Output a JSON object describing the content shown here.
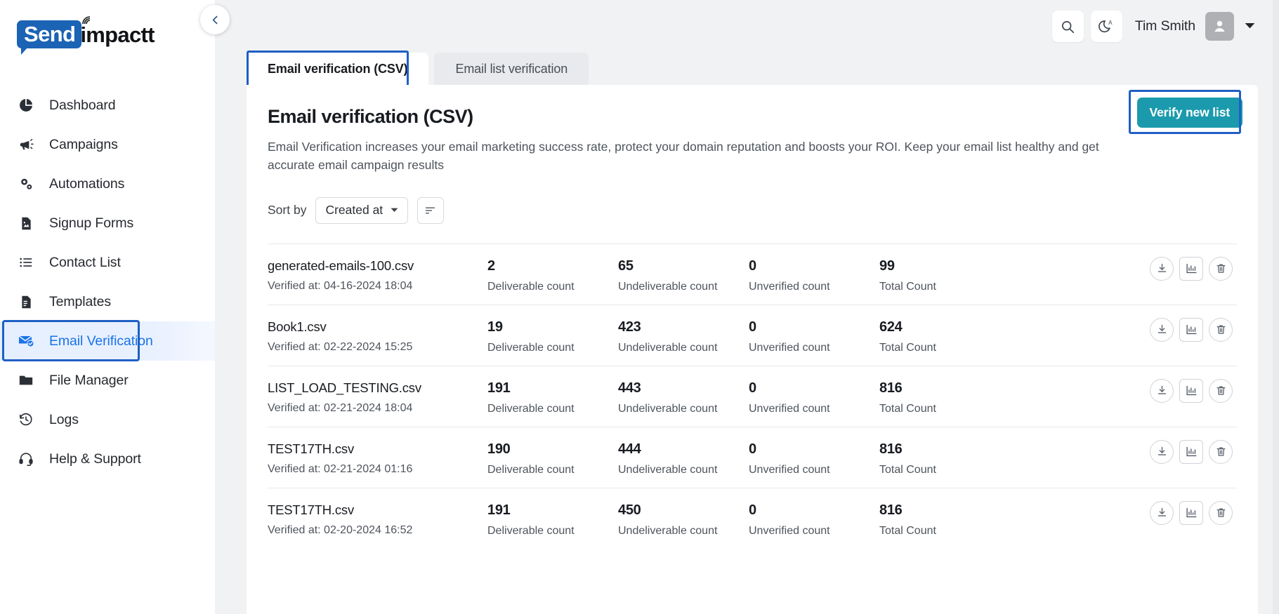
{
  "brand": {
    "word_mark_primary": "Send",
    "word_mark_secondary": "impactt",
    "primary_color": "#1b63b5"
  },
  "sidebar": {
    "collapse_icon": "chevron-left-icon",
    "items": [
      {
        "label": "Dashboard",
        "icon": "pie-chart-icon",
        "active": false
      },
      {
        "label": "Campaigns",
        "icon": "megaphone-icon",
        "active": false
      },
      {
        "label": "Automations",
        "icon": "gears-icon",
        "active": false
      },
      {
        "label": "Signup Forms",
        "icon": "form-image-icon",
        "active": false
      },
      {
        "label": "Contact List",
        "icon": "list-icon",
        "active": false
      },
      {
        "label": "Templates",
        "icon": "document-icon",
        "active": false
      },
      {
        "label": "Email Verification",
        "icon": "mail-check-icon",
        "active": true
      },
      {
        "label": "File Manager",
        "icon": "folder-icon",
        "active": false
      },
      {
        "label": "Logs",
        "icon": "history-clock-icon",
        "active": false
      },
      {
        "label": "Help & Support",
        "icon": "headset-icon",
        "active": false
      }
    ]
  },
  "header": {
    "search_icon": "search-icon",
    "theme_icon": "moon-auto-icon",
    "user_name": "Tim Smith",
    "avatar_icon": "person-icon",
    "caret_icon": "chevron-down-icon"
  },
  "tabs": [
    {
      "label": "Email verification (CSV)",
      "active": true
    },
    {
      "label": "Email list verification",
      "active": false
    }
  ],
  "main": {
    "title": "Email verification (CSV)",
    "description": "Email Verification increases your email marketing success rate, protect your domain reputation and boosts your ROI. Keep your email list healthy and get accurate email campaign results",
    "verify_button": "Verify new list",
    "accent_color": "#1b9aad",
    "annotation_color": "#1f5fc4"
  },
  "sort": {
    "label": "Sort by",
    "selected": "Created at",
    "dropdown_icon": "chevron-down-icon",
    "direction_icon": "sort-order-icon"
  },
  "list": {
    "labels": {
      "deliverable": "Deliverable count",
      "undeliverable": "Undeliverable count",
      "unverified": "Unverified count",
      "total": "Total Count",
      "verified_prefix": "Verified at:"
    },
    "actions": [
      {
        "name": "download-icon"
      },
      {
        "name": "bar-chart-icon"
      },
      {
        "name": "trash-icon"
      }
    ],
    "rows": [
      {
        "filename": "generated-emails-100.csv",
        "verified_at": "Verified at: 04-16-2024 18:04",
        "deliverable": "2",
        "undeliverable": "65",
        "unverified": "0",
        "total": "99"
      },
      {
        "filename": "Book1.csv",
        "verified_at": "Verified at: 02-22-2024 15:25",
        "deliverable": "19",
        "undeliverable": "423",
        "unverified": "0",
        "total": "624"
      },
      {
        "filename": "LIST_LOAD_TESTING.csv",
        "verified_at": "Verified at: 02-21-2024 18:04",
        "deliverable": "191",
        "undeliverable": "443",
        "unverified": "0",
        "total": "816"
      },
      {
        "filename": "TEST17TH.csv",
        "verified_at": "Verified at: 02-21-2024 01:16",
        "deliverable": "190",
        "undeliverable": "444",
        "unverified": "0",
        "total": "816"
      },
      {
        "filename": "TEST17TH.csv",
        "verified_at": "Verified at: 02-20-2024 16:52",
        "deliverable": "191",
        "undeliverable": "450",
        "unverified": "0",
        "total": "816"
      }
    ]
  }
}
